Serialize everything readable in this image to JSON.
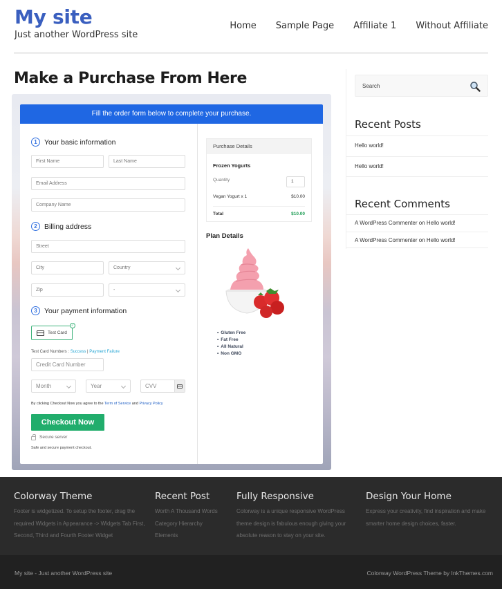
{
  "header": {
    "site_title": "My site",
    "tagline": "Just another WordPress site",
    "nav": [
      "Home",
      "Sample Page",
      "Affiliate 1",
      "Without Affiliate"
    ]
  },
  "page": {
    "title": "Make a Purchase From Here"
  },
  "form": {
    "banner": "Fill the order form below to complete your purchase.",
    "step1": {
      "num": "1",
      "label": "Your basic information"
    },
    "step2": {
      "num": "2",
      "label": "Billing address"
    },
    "step3": {
      "num": "3",
      "label": "Your payment information"
    },
    "placeholders": {
      "first_name": "First Name",
      "last_name": "Last Name",
      "email": "Email Address",
      "company": "Company Name",
      "street": "Street",
      "city": "City",
      "country": "Country",
      "zip": "Zip",
      "state": "-",
      "card_number": "Credit Card Number",
      "month": "Month",
      "year": "Year",
      "cvv": "CVV"
    },
    "payment_method": "Test Card",
    "test_numbers_label": "Test Card Numbers : ",
    "test_success": "Success",
    "test_separator": " | ",
    "test_failure": "Payment Failure",
    "terms_prefix": "By clicking Checkout Now you agree to the ",
    "terms_link": "Term of Service",
    "terms_and": " and ",
    "privacy_link": "Privacy Policy",
    "checkout_button": "Checkout Now",
    "secure_server": "Secure server",
    "safe_text": "Safe and secure payment checkout."
  },
  "purchase_details": {
    "heading": "Purchase Details",
    "product": "Frozen Yogurts",
    "quantity_label": "Quantity",
    "quantity": "1",
    "line_label": "Vegan Yogurt x 1",
    "line_amount": "$10.00",
    "total_label": "Total",
    "total_amount": "$10.00"
  },
  "plan": {
    "title": "Plan Details",
    "features": [
      "Gluten Free",
      "Fat Free",
      "All Natural",
      "Non GMO"
    ]
  },
  "sidebar": {
    "search_placeholder": "Search",
    "recent_posts_title": "Recent Posts",
    "recent_posts": [
      "Hello world!",
      "Hello world!"
    ],
    "recent_comments_title": "Recent Comments",
    "recent_comments": [
      "A WordPress Commenter on Hello world!",
      "A WordPress Commenter on Hello world!"
    ]
  },
  "footer": {
    "cols": [
      {
        "title": "Colorway Theme",
        "text": "Footer is widgetized. To setup the footer, drag the required Widgets in Appearance -> Widgets Tab First, Second, Third and Fourth Footer Widget"
      },
      {
        "title": "Recent Post",
        "links": [
          "Worth A Thousand Words",
          "Category Hierarchy",
          "Elements"
        ]
      },
      {
        "title": "Fully Responsive",
        "text": "Colorway is a unique responsive WordPress theme design is fabulous enough giving your absolute reason to stay on your site."
      },
      {
        "title": "Design Your Home",
        "text": "Express your creativity, find inspiration and make smarter home design choices, faster."
      }
    ],
    "bottom_left": "My site - Just another WordPress site",
    "bottom_right": "Colorway WordPress Theme by InkThemes.com"
  },
  "colors": {
    "brand_blue": "#3a5fbf",
    "banner_blue": "#1f67e3",
    "checkout_green": "#21ad6c",
    "total_green": "#1f9d55"
  }
}
